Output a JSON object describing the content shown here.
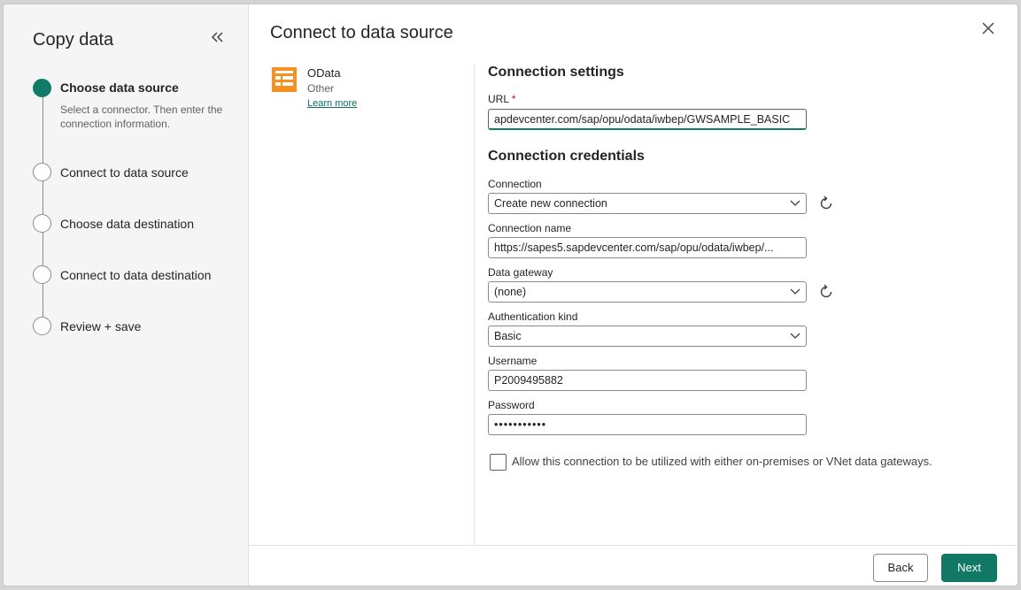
{
  "sidebar": {
    "title": "Copy data",
    "collapse_icon": "double-chevron-left-icon",
    "steps": [
      {
        "label": "Choose data source",
        "desc": "Select a connector. Then enter the connection information.",
        "active": true
      },
      {
        "label": "Connect to data source",
        "active": false
      },
      {
        "label": "Choose data destination",
        "active": false
      },
      {
        "label": "Connect to data destination",
        "active": false
      },
      {
        "label": "Review + save",
        "active": false
      }
    ]
  },
  "header": {
    "title": "Connect to data source",
    "close_icon": "close-icon"
  },
  "connector": {
    "name": "OData",
    "category": "Other",
    "learn_more": "Learn more",
    "icon": "odata-icon",
    "icon_color": "#f7901e"
  },
  "settings": {
    "title": "Connection settings",
    "url_label": "URL",
    "url_required": "*",
    "url_value": "apdevcenter.com/sap/opu/odata/iwbep/GWSAMPLE_BASIC"
  },
  "credentials": {
    "title": "Connection credentials",
    "connection_label": "Connection",
    "connection_value": "Create new connection",
    "connection_name_label": "Connection name",
    "connection_name_value": "https://sapes5.sapdevcenter.com/sap/opu/odata/iwbep/...",
    "gateway_label": "Data gateway",
    "gateway_value": "(none)",
    "auth_label": "Authentication kind",
    "auth_value": "Basic",
    "username_label": "Username",
    "username_value": "P2009495882",
    "password_label": "Password",
    "password_value": "•••••••••••"
  },
  "gateway_checkbox": {
    "label": "Allow this connection to be utilized with either on-premises or VNet data gateways.",
    "checked": false
  },
  "footer": {
    "back": "Back",
    "next": "Next"
  },
  "colors": {
    "accent": "#117865",
    "step_active": "#107c68",
    "required": "#c50f1f"
  }
}
